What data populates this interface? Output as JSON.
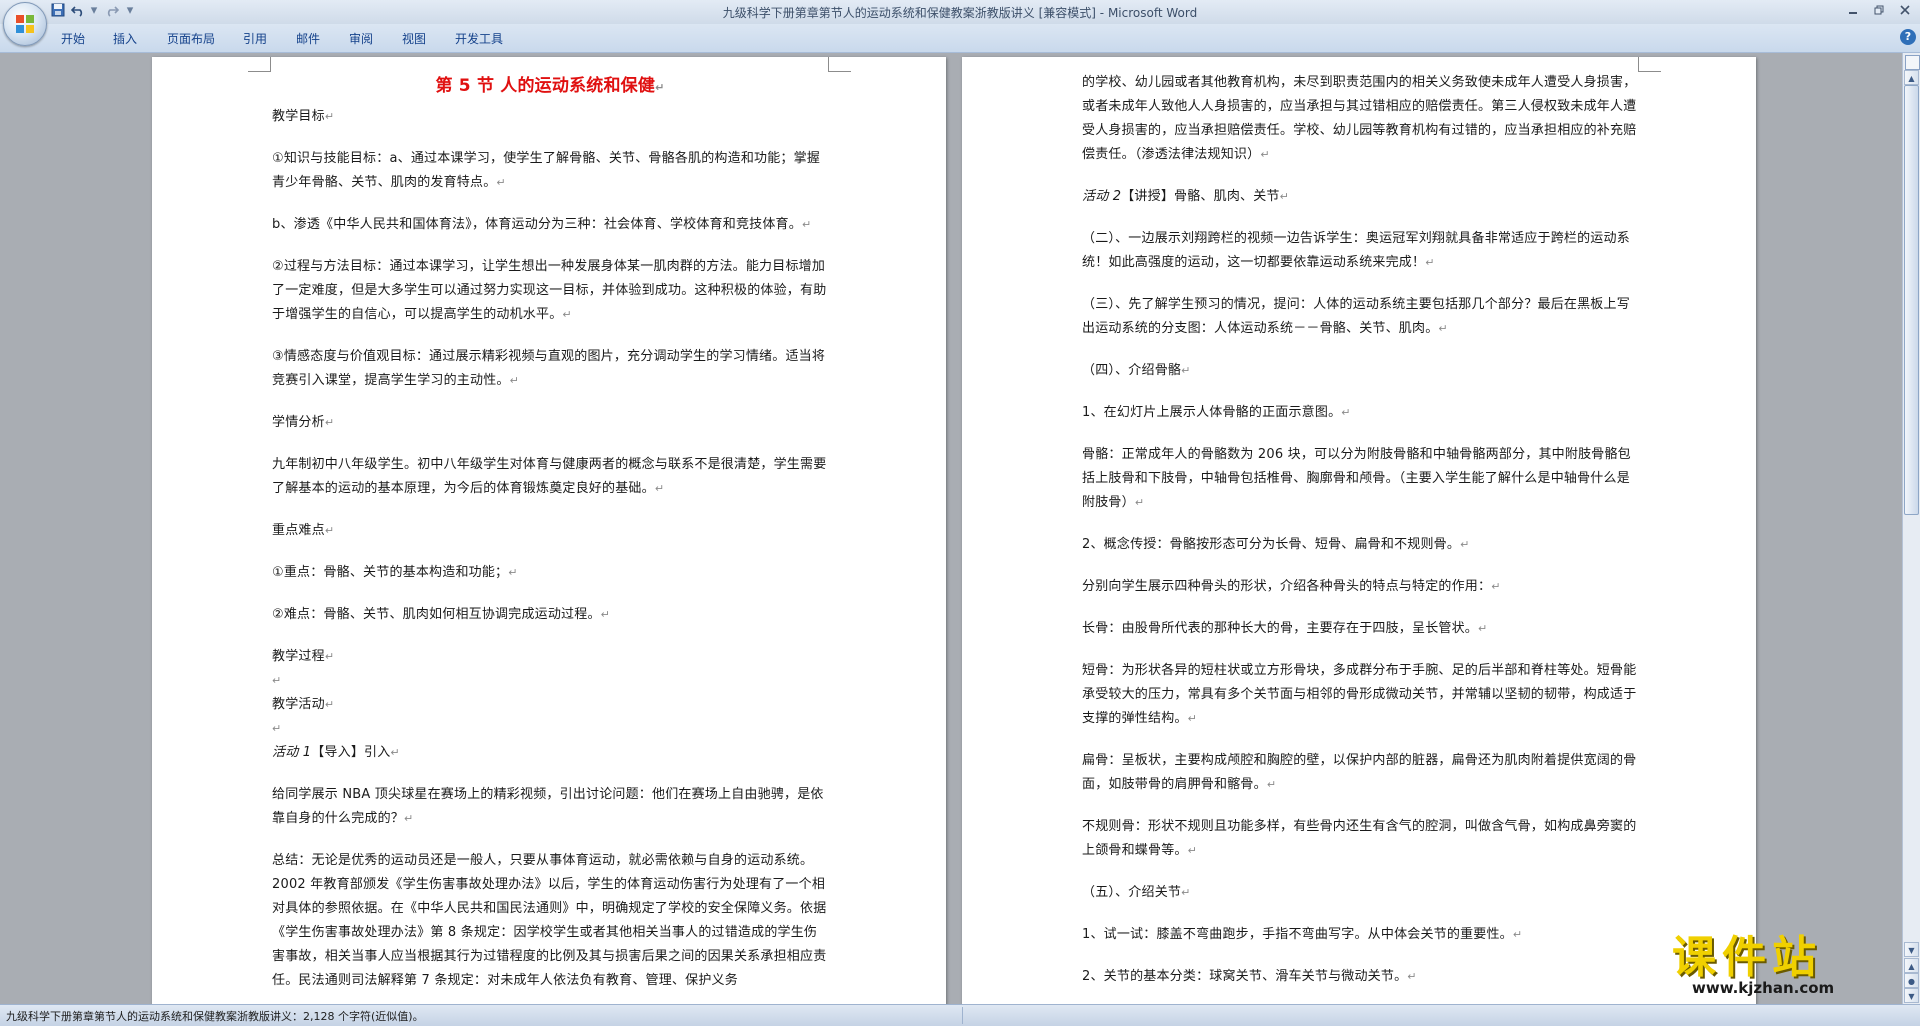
{
  "window": {
    "title_doc": "九级科学下册第章第节人的运动系统和保健教案浙教版讲义 [兼容模式]",
    "title_app": "Microsoft Word",
    "title_sep": " - "
  },
  "quick_access": {
    "save_icon": "save-icon",
    "undo_icon": "undo-icon",
    "redo_icon": "redo-icon",
    "customize_icon": "dropdown-icon"
  },
  "ribbon": {
    "tabs": [
      "开始",
      "插入",
      "页面布局",
      "引用",
      "邮件",
      "审阅",
      "视图",
      "开发工具"
    ]
  },
  "page_left": {
    "title": "第 5 节  人的运动系统和保健",
    "paragraphs": [
      "教学目标",
      "①知识与技能目标：a、通过本课学习，使学生了解骨骼、关节、骨骼各肌的构造和功能；掌握青少年骨骼、关节、肌肉的发育特点。",
      "b、渗透《中华人民共和国体育法》，体育运动分为三种：社会体育、学校体育和竞技体育。",
      "②过程与方法目标：通过本课学习，让学生想出一种发展身体某一肌肉群的方法。能力目标增加了一定难度，但是大多学生可以通过努力实现这一目标，并体验到成功。这种积极的体验，有助于增强学生的自信心，可以提高学生的动机水平。",
      "③情感态度与价值观目标：通过展示精彩视频与直观的图片，充分调动学生的学习情绪。适当将竞赛引入课堂，提高学生学习的主动性。",
      "学情分析",
      "九年制初中八年级学生。初中八年级学生对体育与健康两者的概念与联系不是很清楚，学生需要了解基本的运动的基本原理，为今后的体育锻炼奠定良好的基础。",
      "重点难点",
      "①重点：骨骼、关节的基本构造和功能；",
      "②难点：骨骼、关节、肌肉如何相互协调完成运动过程。"
    ],
    "process_heading": "教学过程",
    "activity_heading": "教学活动",
    "activity1_label": "活动 1",
    "activity1_text": "【导入】引入",
    "intro_para": "给同学展示 NBA 顶尖球星在赛场上的精彩视频，引出讨论问题：他们在赛场上自由驰骋，是依靠自身的什么完成的？",
    "summary_para": "总结：无论是优秀的运动员还是一般人，只要从事体育运动，就必需依赖与自身的运动系统。2002 年教育部颁发《学生伤害事故处理办法》以后，学生的体育运动伤害行为处理有了一个相对具体的参照依据。在《中华人民共和国民法通则》中，明确规定了学校的安全保障义务。依据《学生伤害事故处理办法》第 8 条规定：因学校学生或者其他相关当事人的过错造成的学生伤害事故，相关当事人应当根据其行为过错程度的比例及其与损害后果之间的因果关系承担相应责任。民法通则司法解释第 7 条规定：对未成年人依法负有教育、管理、保护义务"
  },
  "page_right": {
    "para_cont": "的学校、幼儿园或者其他教育机构，未尽到职责范围内的相关义务致使未成年人遭受人身损害，或者未成年人致他人人身损害的，应当承担与其过错相应的赔偿责任。第三人侵权致未成年人遭受人身损害的，应当承担赔偿责任。学校、幼儿园等教育机构有过错的，应当承担相应的补充赔偿责任。（渗透法律法规知识）",
    "activity2_label": "活动 2",
    "activity2_text": "【讲授】骨骼、肌肉、关节",
    "paragraphs": [
      "（二）、一边展示刘翔跨栏的视频一边告诉学生：奥运冠军刘翔就具备非常适应于跨栏的运动系统！如此高强度的运动，这一切都要依靠运动系统来完成！",
      "（三）、先了解学生预习的情况，提问：人体的运动系统主要包括那几个部分？最后在黑板上写出运动系统的分支图：人体运动系统－－骨骼、关节、肌肉。",
      "（四）、介绍骨骼",
      "1、在幻灯片上展示人体骨骼的正面示意图。",
      "骨骼：正常成年人的骨骼数为 206 块，可以分为附肢骨骼和中轴骨骼两部分，其中附肢骨骼包括上肢骨和下肢骨，中轴骨包括椎骨、胸廓骨和颅骨。（主要入学生能了解什么是中轴骨什么是附肢骨）",
      "2、概念传授：骨骼按形态可分为长骨、短骨、扁骨和不规则骨。",
      "分别向学生展示四种骨头的形状，介绍各种骨头的特点与特定的作用：",
      "长骨：由股骨所代表的那种长大的骨，主要存在于四肢，呈长管状。",
      "短骨：为形状各异的短柱状或立方形骨块，多成群分布于手腕、足的后半部和脊柱等处。短骨能承受较大的压力，常具有多个关节面与相邻的骨形成微动关节，并常辅以坚韧的韧带，构成适于支撑的弹性结构。",
      "扁骨：呈板状，主要构成颅腔和胸腔的壁，以保护内部的脏器，扁骨还为肌肉附着提供宽阔的骨面，如肢带骨的肩胛骨和髂骨。",
      "不规则骨：形状不规则且功能多样，有些骨内还生有含气的腔洞，叫做含气骨，如构成鼻旁窦的上颌骨和蝶骨等。",
      "（五）、介绍关节",
      "1、试一试：膝盖不弯曲跑步，手指不弯曲写字。从中体会关节的重要性。",
      "2、关节的基本分类：球窝关节、滑车关节与微动关节。"
    ]
  },
  "statusbar": {
    "text": "九级科学下册第章第节人的运动系统和保健教案浙教版讲义：2,128 个字符(近似值)。"
  },
  "watermark": {
    "title": "课件站",
    "url": "www.kjzhan.com"
  },
  "paragraph_mark": "↵"
}
